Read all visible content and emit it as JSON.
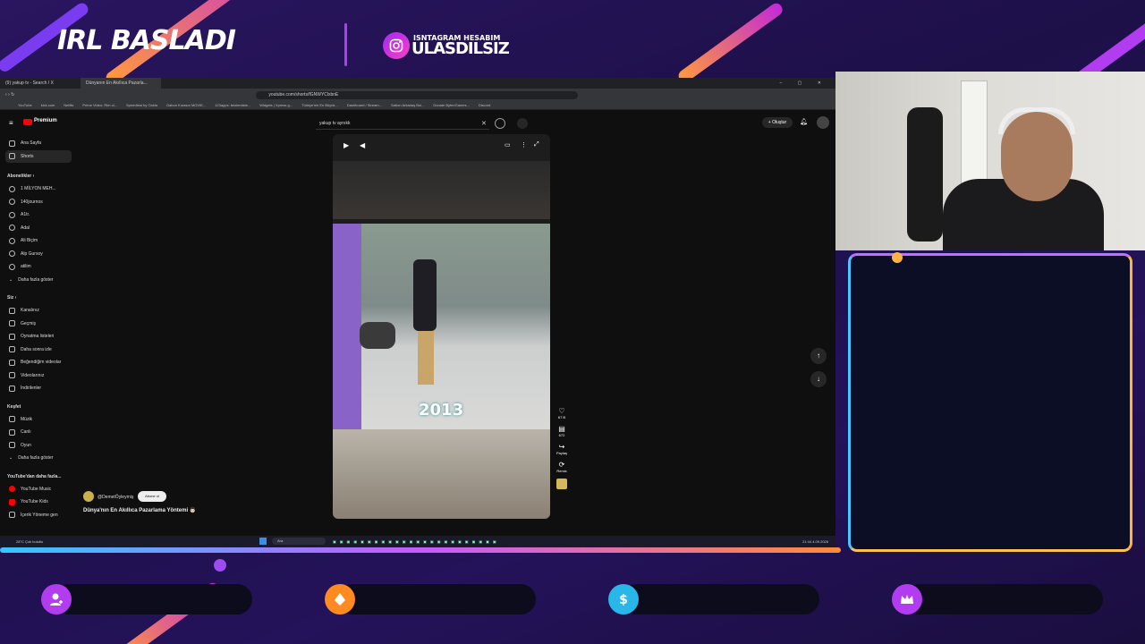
{
  "overlay": {
    "title": "IRL BASLADI",
    "ig_label": "ISNTAGRAM HESABIM",
    "ig_handle": "ULASDILSIZ"
  },
  "browser": {
    "tabs": [
      "(9) yakup tv - Search / X",
      "Dünyanın En Akıllıca Pazarla..."
    ],
    "url": "youtube.com/shorts/fGNWYClxbnE",
    "bookmarks": [
      "YouTube",
      "kick.com",
      "Netflix",
      "Prime Video: Rim ol...",
      "Speedtest by Ookla",
      "Gabon Kurasın MOVIE...",
      "123apps: tetzlemiste...",
      "Widgets | Xpress g...",
      "Türkiye'nin En Büyük...",
      "Dashboard / Stream...",
      "Sabon Arkadaş Bul...",
      "Donate Byfm/Games...",
      "Discord"
    ]
  },
  "youtube": {
    "logo": "Premium",
    "search": "yakup tv aynıkk",
    "create": "Oluştur",
    "nav": [
      "Ana Sayfa",
      "Shorts"
    ],
    "subs_heading": "Abonelikler",
    "subs": [
      "1 MİLYON MEH...",
      "140journos",
      "A1tr.",
      "Adal",
      "Ali Biçim",
      "Alp Gursoy",
      "atilim",
      "Daha fazla göster"
    ],
    "you_heading": "Siz",
    "you": [
      "Kanalınız",
      "Geçmiş",
      "Oynatma listeleri",
      "Daha sonra izle",
      "Beğendiğim videolar",
      "Videolarınız",
      "İndirilenler"
    ],
    "explore_heading": "Keşfet",
    "explore": [
      "Müzik",
      "Canlı",
      "Oyun",
      "Daha fazla göster"
    ],
    "more_heading": "YouTube'dan daha fazla...",
    "more": [
      "YouTube Music",
      "YouTube Kids"
    ],
    "more_last": "İçerik Yöneme gen",
    "short": {
      "channel": "@DemetÖyleymiş",
      "subscribe": "Abone ol",
      "title": "Dünya'nın En Akıllıca Pazarlama Yöntemi 👨🏻",
      "year": "2013",
      "likes": "67 B",
      "comments": "672",
      "share": "Paylaş",
      "remix": "Remix"
    }
  },
  "taskbar": {
    "weather": "28°C",
    "weather2": "Çok bulutlu",
    "search": "Ara",
    "time": "21:44",
    "date": "4.09.2026"
  },
  "colors": {
    "bg": "#1d1048",
    "accent": "#b23cf0",
    "orange": "#ff8a3d",
    "cyan": "#37c6ff"
  },
  "icons": [
    "person-add-icon",
    "diamond-icon",
    "dollar-icon",
    "crown-icon"
  ]
}
